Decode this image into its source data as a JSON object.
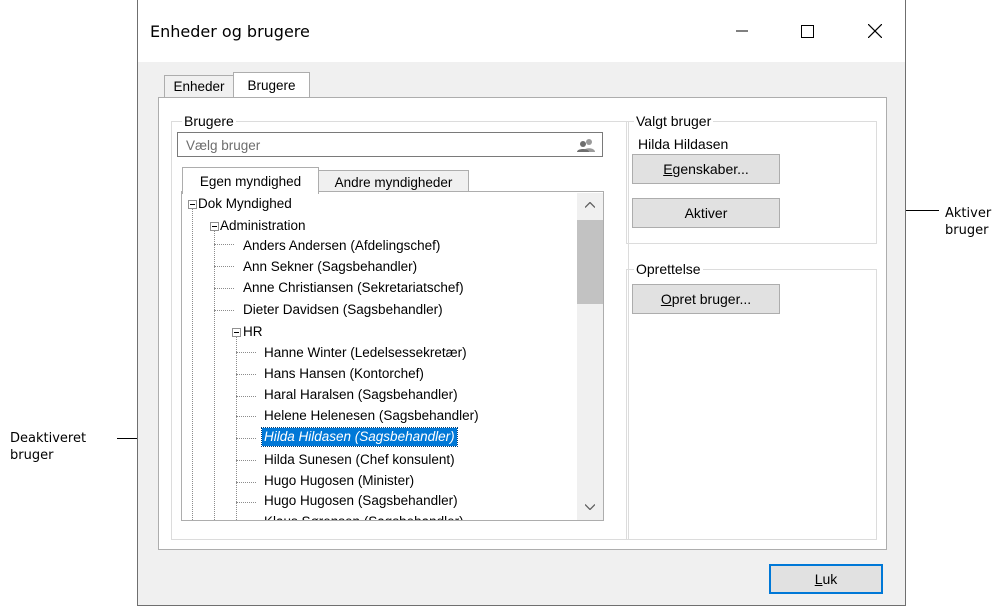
{
  "window": {
    "title": "Enheder og brugere",
    "controls": [
      "minimize-icon",
      "maximize-icon",
      "close-icon"
    ]
  },
  "tabs": [
    {
      "label": "Enheder",
      "active": false
    },
    {
      "label": "Brugere",
      "active": true
    }
  ],
  "users_group": {
    "label": "Brugere",
    "search_placeholder": "Vælg bruger",
    "search_icon": "users-icon",
    "inner_tabs": [
      {
        "label": "Egen myndighed",
        "active": true
      },
      {
        "label": "Andre myndigheder",
        "active": false
      }
    ],
    "tree": {
      "root": "Dok Myndighed",
      "administration": "Administration",
      "admin_users": [
        "Anders Andersen (Afdelingschef)",
        "Ann Sekner (Sagsbehandler)",
        "Anne Christiansen (Sekretariatschef)",
        "Dieter Davidsen (Sagsbehandler)"
      ],
      "hr": "HR",
      "hr_users": [
        "Hanne Winter (Ledelsessekretær)",
        "Hans Hansen (Kontorchef)",
        "Haral Haralsen (Sagsbehandler)",
        "Helene Helenesen (Sagsbehandler)",
        "Hilda Hildasen (Sagsbehandler)",
        "Hilda Sunesen  (Chef konsulent)",
        "Hugo Hugosen (Minister)",
        "Hugo Hugosen (Sagsbehandler)",
        "Klaus Sørensen (Sagsbehandler)"
      ],
      "selected": "Hilda Hildasen (Sagsbehandler)"
    }
  },
  "selected_group": {
    "label": "Valgt bruger",
    "user_name": "Hilda Hildasen",
    "properties_button": {
      "prefix": "E",
      "rest": "genskaber..."
    },
    "activate_button": "Aktiver"
  },
  "create_group": {
    "label": "Oprettelse",
    "create_button": {
      "prefix": "O",
      "rest": "pret bruger..."
    }
  },
  "close_button": {
    "prefix": "L",
    "rest": "uk"
  },
  "callouts": {
    "left": [
      "Deaktiveret",
      "bruger"
    ],
    "right": [
      "Aktiver",
      "bruger"
    ]
  }
}
